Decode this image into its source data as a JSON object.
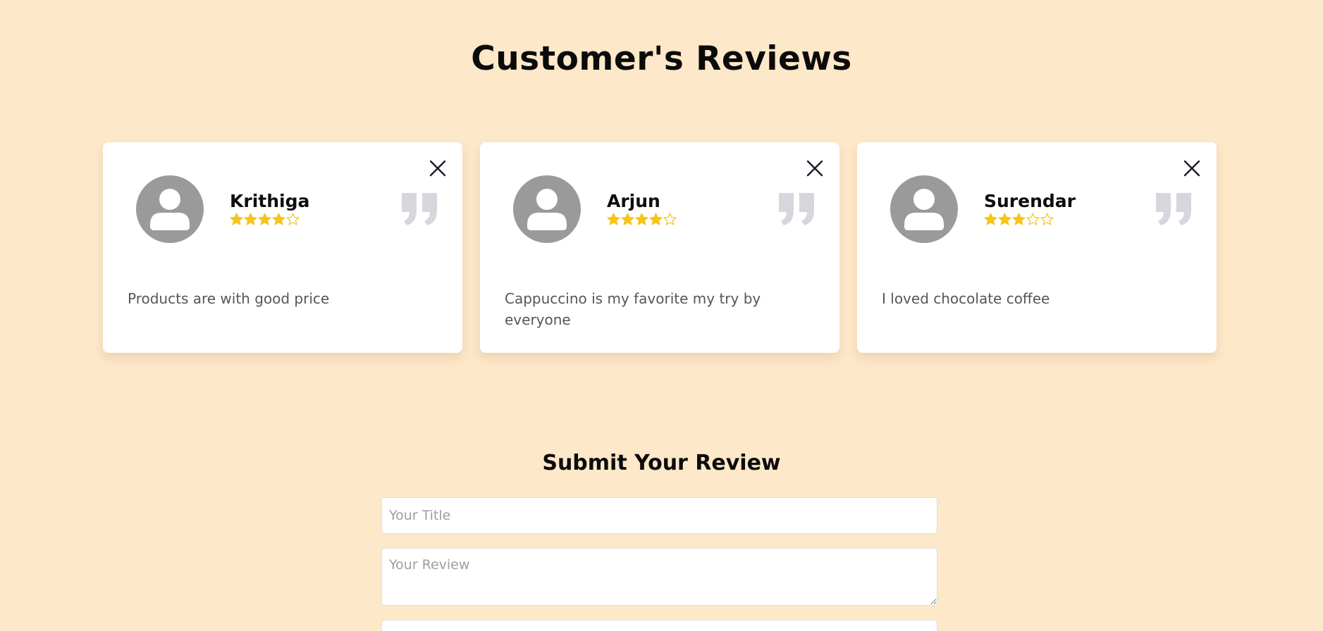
{
  "page": {
    "title": "Customer's Reviews"
  },
  "colors": {
    "background": "#fde8c9",
    "card": "#ffffff",
    "star": "#f5c518",
    "avatar": "#9a9a9a",
    "quote": "#d6d6dc"
  },
  "reviews": [
    {
      "name": "Krithiga",
      "rating": 4,
      "max_rating": 5,
      "text": "Products are with good price"
    },
    {
      "name": "Arjun",
      "rating": 4,
      "max_rating": 5,
      "text": "Cappuccino is my favorite my try by everyone"
    },
    {
      "name": "Surendar",
      "rating": 3,
      "max_rating": 5,
      "text": "I loved chocolate coffee"
    }
  ],
  "form": {
    "heading": "Submit Your Review",
    "title_placeholder": "Your Title",
    "review_placeholder": "Your Review"
  }
}
